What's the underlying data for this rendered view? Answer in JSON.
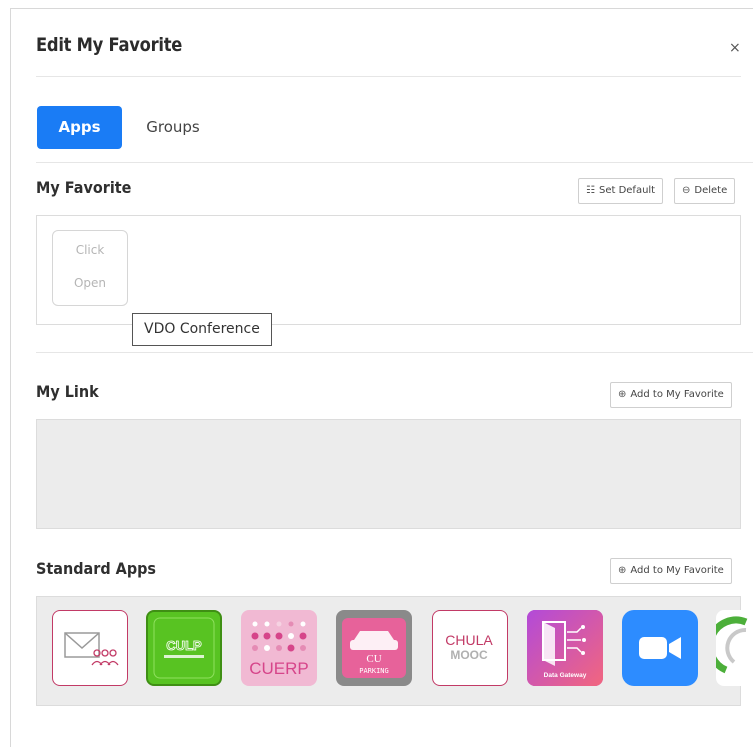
{
  "dialog": {
    "title": "Edit My Favorite",
    "close_label": "×"
  },
  "tabs": [
    {
      "label": "Apps",
      "active": true
    },
    {
      "label": "Groups",
      "active": false
    }
  ],
  "my_favorite": {
    "title": "My Favorite",
    "set_default_icon": "grid-icon",
    "set_default_label": "Set Default",
    "delete_icon": "minus-circle-icon",
    "delete_label": "Delete",
    "placeholder_line1": "Click",
    "placeholder_line2": "Open",
    "tooltip": "VDO Conference"
  },
  "my_link": {
    "title": "My Link",
    "add_icon": "plus-circle-icon",
    "add_label": "Add to My Favorite"
  },
  "standard_apps": {
    "title": "Standard Apps",
    "add_icon": "plus-circle-icon",
    "add_label": "Add to My Favorite",
    "apps": [
      {
        "icon": "mail-group-icon"
      },
      {
        "icon": "cu-lead-player-icon",
        "text": "CULP"
      },
      {
        "icon": "cuerp-icon",
        "text": "CUERP"
      },
      {
        "icon": "cu-parking-icon",
        "text1": "CU",
        "text2": "PARKING"
      },
      {
        "icon": "chula-mooc-icon",
        "text1": "CHULA",
        "text2": "MOOC"
      },
      {
        "icon": "data-gateway-icon",
        "text": "Data Gateway"
      },
      {
        "icon": "zoom-icon"
      },
      {
        "icon": "partial-app-icon"
      }
    ]
  },
  "colors": {
    "accent": "#1a7cf5",
    "panel_gray": "#ececec",
    "zoom_blue": "#2d8cff",
    "lead_green": "#58c322",
    "erp_pink": "#f1b9d3"
  }
}
